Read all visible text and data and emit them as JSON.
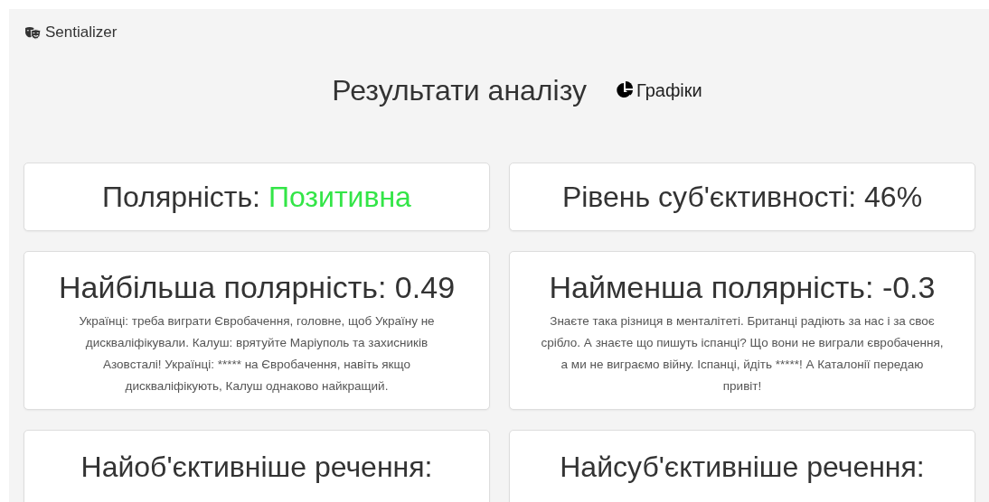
{
  "navbar": {
    "brand": "Sentializer"
  },
  "header": {
    "title": "Результати аналізу",
    "charts_link": "Графіки"
  },
  "cards": [
    {
      "heading": "Полярність:",
      "value": "Позитивна",
      "color": "#33e547"
    },
    {
      "heading": "Рівень суб'єктивності: 46%"
    },
    {
      "heading": "Найбільша полярність: 0.49",
      "text": "Українці: треба виграти Євробачення, головне, щоб Україну не дискваліфікували. Калуш: врятуйте Маріуполь та захисників Азовсталі! Українці: ***** на Євробачення, навіть якщо дискваліфікують, Калуш однаково найкращий."
    },
    {
      "heading": "Найменша полярність: -0.3",
      "text": "Знаєте така різниця в менталітеті. Британці радіють за нас і за своє срібло. А знаєте що пишуть іспанці? Що вони не виграли євробачення, а ми не виграємо війну. Іспанці, йдіть *****! А Каталонії передаю привіт!"
    },
    {
      "heading": "Найоб'єктивніше речення:"
    },
    {
      "heading": "Найсуб'єктивніше речення:"
    }
  ]
}
